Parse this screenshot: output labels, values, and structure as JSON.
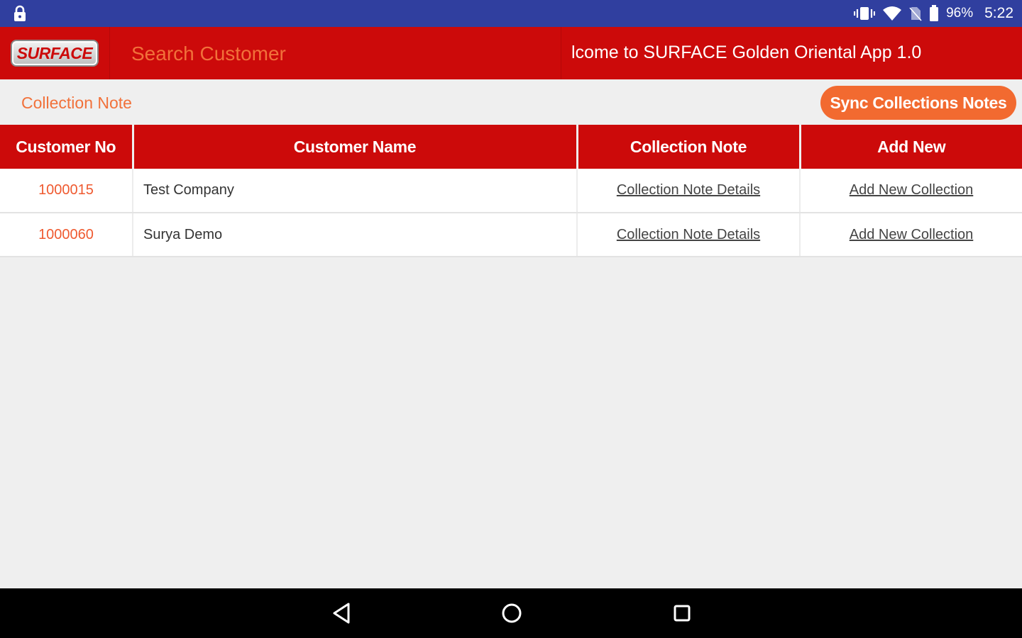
{
  "status_bar": {
    "battery": "96%",
    "time": "5:22",
    "icons": [
      "lock-icon",
      "vibrate-icon",
      "wifi-icon",
      "no-sim-icon",
      "battery-icon"
    ]
  },
  "header": {
    "logo_text": "SURFACE",
    "search_label": "Search Customer",
    "welcome_text": "lcome to SURFACE Golden Oriental App 1.0"
  },
  "subheader": {
    "title": "Collection Note",
    "sync_label": "Sync Collections Notes"
  },
  "table": {
    "columns": [
      "Customer No",
      "Customer Name",
      "Collection Note",
      "Add New"
    ],
    "rows": [
      {
        "customer_no": "1000015",
        "customer_name": "Test Company",
        "note_link": "Collection Note Details",
        "add_link": "Add New Collection"
      },
      {
        "customer_no": "1000060",
        "customer_name": "Surya Demo",
        "note_link": "Collection Note Details",
        "add_link": "Add New Collection"
      }
    ]
  },
  "colors": {
    "status_bar": "#303f9f",
    "header_red": "#cc0a0a",
    "accent_orange": "#f26a30",
    "background": "#efefef"
  },
  "nav_bar": {
    "icons": [
      "back-icon",
      "home-icon",
      "recent-apps-icon"
    ]
  }
}
